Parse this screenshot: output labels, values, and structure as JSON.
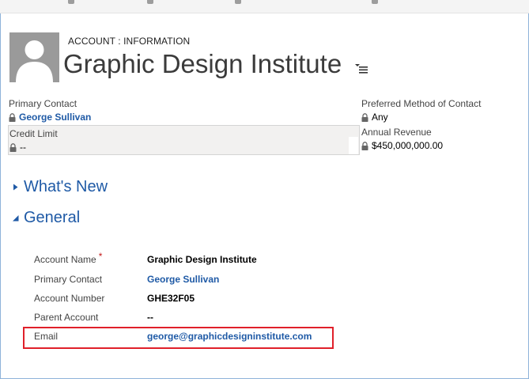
{
  "header": {
    "entity_label": "ACCOUNT : INFORMATION",
    "record_title": "Graphic Design Institute",
    "menu_icon": "list-menu-icon",
    "avatar_icon": "person-silhouette-icon"
  },
  "header_fields": {
    "primary_contact": {
      "label": "Primary Contact",
      "value": "George Sullivan"
    },
    "credit_limit": {
      "label": "Credit Limit",
      "value": "--"
    },
    "preferred_method": {
      "label": "Preferred Method of Contact",
      "value": "Any"
    },
    "annual_revenue": {
      "label": "Annual Revenue",
      "value": "$450,000,000.00"
    }
  },
  "sections": {
    "whats_new": {
      "title": "What's New",
      "expanded": false
    },
    "general": {
      "title": "General",
      "expanded": true
    }
  },
  "general_fields": [
    {
      "label": "Account Name",
      "required": "*",
      "value": "Graphic Design Institute",
      "is_link": false
    },
    {
      "label": "Primary Contact",
      "value": "George Sullivan",
      "is_link": true
    },
    {
      "label": "Account Number",
      "value": "GHE32F05",
      "is_link": false
    },
    {
      "label": "Parent Account",
      "value": "--",
      "is_link": false
    },
    {
      "label": "Email",
      "value": "george@graphicdesigninstitute.com",
      "is_link": true
    }
  ],
  "colors": {
    "link": "#1f5aa6",
    "highlight": "#e0202a",
    "required": "#c41a1a"
  }
}
